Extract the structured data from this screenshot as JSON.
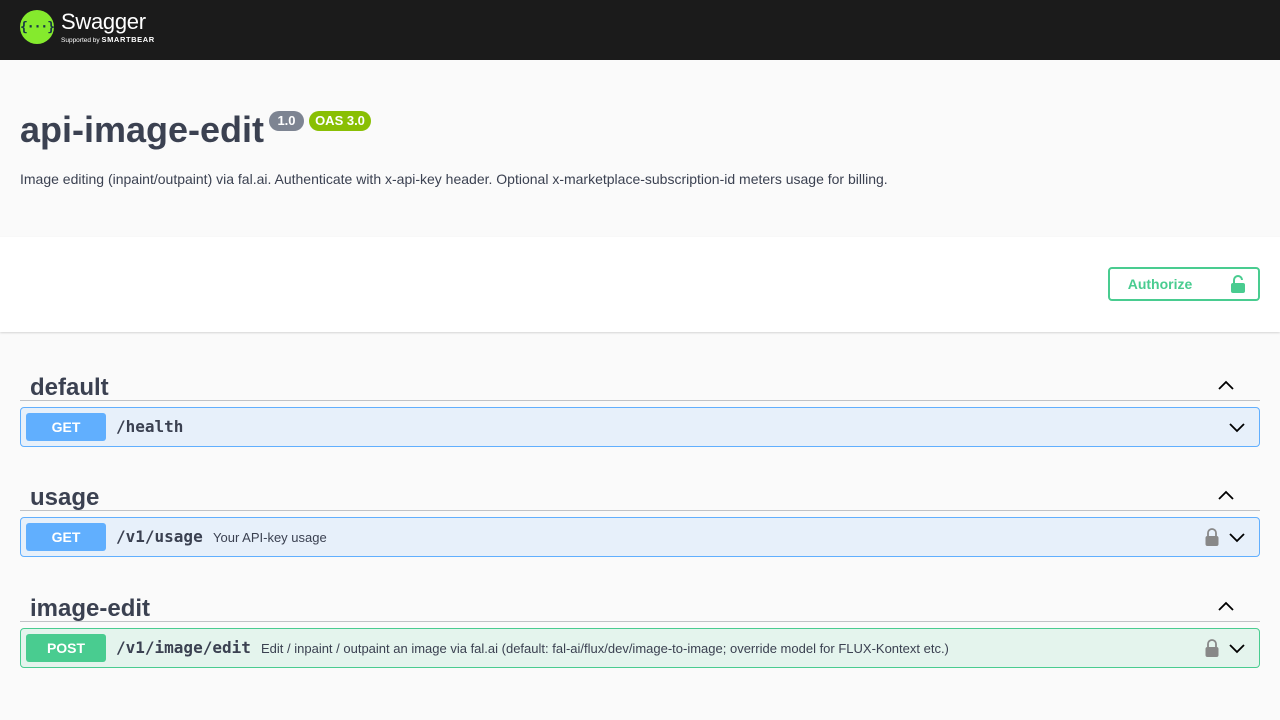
{
  "topbar": {
    "logo_glyph": "{···}",
    "brand": "Swagger",
    "supported_by": "Supported by",
    "sponsor": "SMARTBEAR"
  },
  "info": {
    "title": "api-image-edit",
    "version": "1.0",
    "oas": "OAS 3.0",
    "description": "Image editing (inpaint/outpaint) via fal.ai. Authenticate with x-api-key header. Optional x-marketplace-subscription-id meters usage for billing."
  },
  "scheme": {
    "authorize_label": "Authorize"
  },
  "colors": {
    "get": "#61affe",
    "post": "#49cc90",
    "topbar": "#1b1b1b",
    "logo": "#85ea2d",
    "version_badge": "#7d8492",
    "oas_badge": "#89bf04"
  },
  "tags": [
    {
      "name": "default",
      "operations": [
        {
          "method": "GET",
          "path": "/health",
          "summary": "",
          "locked": false
        }
      ]
    },
    {
      "name": "usage",
      "operations": [
        {
          "method": "GET",
          "path": "/v1/usage",
          "summary": "Your API-key usage",
          "locked": true
        }
      ]
    },
    {
      "name": "image-edit",
      "operations": [
        {
          "method": "POST",
          "path": "/v1/image/edit",
          "summary": "Edit / inpaint / outpaint an image via fal.ai (default: fal-ai/flux/dev/image-to-image; override model for FLUX-Kontext etc.)",
          "locked": true
        }
      ]
    }
  ]
}
